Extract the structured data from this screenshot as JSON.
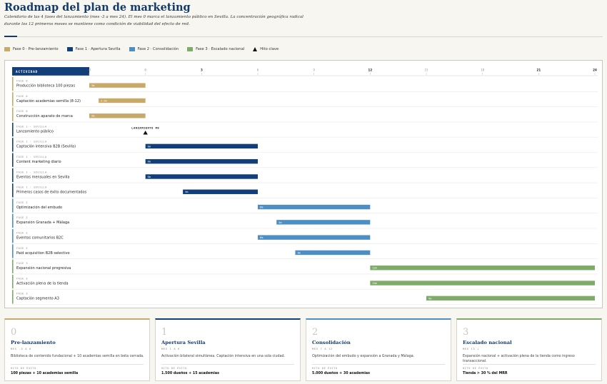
{
  "header": {
    "title": "Roadmap del plan de marketing",
    "subtitle": "Calendario de las 4 fases del lanzamiento (mes -3 a mes 24). El mes 0 marca el lanzamiento público en Sevilla. La concentración geográfica radical durante los 12 primeros meses se mantiene como condición de viabilidad del efecto de red."
  },
  "legend": [
    {
      "label": "Fase 0 · Pre-lanzamiento",
      "color": "#c9a96a",
      "icon": "swatch"
    },
    {
      "label": "Fase 1 · Apertura Sevilla",
      "color": "#123f7a",
      "icon": "swatch"
    },
    {
      "label": "Fase 2 · Consolidación",
      "color": "#4d8fc4",
      "icon": "swatch"
    },
    {
      "label": "Fase 3 · Escalado nacional",
      "color": "#7fab6a",
      "icon": "swatch"
    },
    {
      "label": "Hito clave",
      "color": "#111111",
      "icon": "triangle"
    }
  ],
  "chart_data": {
    "type": "gantt",
    "activity_header": "ACTIVIDAD",
    "x_ticks": [
      "-3",
      "0",
      "3",
      "6",
      "9",
      "12",
      "15",
      "18",
      "21",
      "24"
    ],
    "x_major_ticks": [
      "3",
      "12",
      "21",
      "24"
    ],
    "xlim": [
      -3,
      24
    ],
    "phase_colors": {
      "0": "#c9a96a",
      "1": "#123f7a",
      "2": "#4d8fc4",
      "3": "#7fab6a"
    },
    "rows": [
      {
        "phase": 0,
        "tag": "FASE 0",
        "name": "Producción biblioteca 100 piezas",
        "start": -3,
        "end": 0,
        "label": "3m"
      },
      {
        "phase": 0,
        "tag": "FASE 0",
        "name": "Captación academias semilla (8-12)",
        "start": -2.5,
        "end": 0,
        "label": "2.5m"
      },
      {
        "phase": 0,
        "tag": "FASE 0",
        "name": "Construcción aparato de marca",
        "start": -3,
        "end": 0,
        "label": "3m"
      },
      {
        "phase": 1,
        "tag": "FASE 1 · SEVILLA",
        "name": "Lanzamiento público",
        "milestone": 0,
        "label": "LANZAMIENTO M0"
      },
      {
        "phase": 1,
        "tag": "FASE 1 · SEVILLA",
        "name": "Captación intensiva B2B (Sevilla)",
        "start": 0,
        "end": 6,
        "label": "6m"
      },
      {
        "phase": 1,
        "tag": "FASE 1 · SEVILLA",
        "name": "Content marketing diario",
        "start": 0,
        "end": 6,
        "label": "6m"
      },
      {
        "phase": 1,
        "tag": "FASE 1 · SEVILLA",
        "name": "Eventos mensuales en Sevilla",
        "start": 0,
        "end": 6,
        "label": "6m"
      },
      {
        "phase": 1,
        "tag": "FASE 1 · SEVILLA",
        "name": "Primeros casos de éxito documentados",
        "start": 2,
        "end": 6,
        "label": "4m"
      },
      {
        "phase": 2,
        "tag": "FASE 2",
        "name": "Optimización del embudo",
        "start": 6,
        "end": 12,
        "label": "6m"
      },
      {
        "phase": 2,
        "tag": "FASE 2",
        "name": "Expansión Granada + Málaga",
        "start": 7,
        "end": 12,
        "label": "5m"
      },
      {
        "phase": 2,
        "tag": "FASE 2",
        "name": "Eventos comunitarios B2C",
        "start": 6,
        "end": 12,
        "label": "6m"
      },
      {
        "phase": 2,
        "tag": "FASE 2",
        "name": "Paid acquisition B2B selectivo",
        "start": 8,
        "end": 12,
        "label": "4m"
      },
      {
        "phase": 3,
        "tag": "FASE 3",
        "name": "Expansión nacional progresiva",
        "start": 12,
        "end": 24,
        "label": "12m"
      },
      {
        "phase": 3,
        "tag": "FASE 3",
        "name": "Activación plena de la tienda",
        "start": 12,
        "end": 24,
        "label": "12m"
      },
      {
        "phase": 3,
        "tag": "FASE 3",
        "name": "Captación segmento A3",
        "start": 15,
        "end": 24,
        "label": "9m"
      }
    ]
  },
  "cards": [
    {
      "num": "0",
      "name": "Pre-lanzamiento",
      "months": "MES -3 A 0",
      "desc": "Biblioteca de contenido fundacional + 10 academias semilla en beta cerrada.",
      "kpi_label": "HITO DE ÉXITO",
      "kpi": "100 piezas + 10 academias semilla",
      "color": "#c9a96a"
    },
    {
      "num": "1",
      "name": "Apertura Sevilla",
      "months": "MES 1 A 6",
      "desc": "Activación bilateral simultánea. Captación intensiva en una sola ciudad.",
      "kpi_label": "HITO DE ÉXITO",
      "kpi": "1.500 dueños + 15 academias",
      "color": "#123f7a"
    },
    {
      "num": "2",
      "name": "Consolidación",
      "months": "MES 7 A 12",
      "desc": "Optimización del embudo y expansión a Granada y Málaga.",
      "kpi_label": "HITO DE ÉXITO",
      "kpi": "5.000 dueños + 30 academias",
      "color": "#4d8fc4"
    },
    {
      "num": "3",
      "name": "Escalado nacional",
      "months": "MES 13 +",
      "desc": "Expansión nacional + activación plena de la tienda como ingreso transaccional.",
      "kpi_label": "HITO DE ÉXITO",
      "kpi": "Tienda > 30 % del MRR",
      "color": "#7fab6a"
    }
  ]
}
